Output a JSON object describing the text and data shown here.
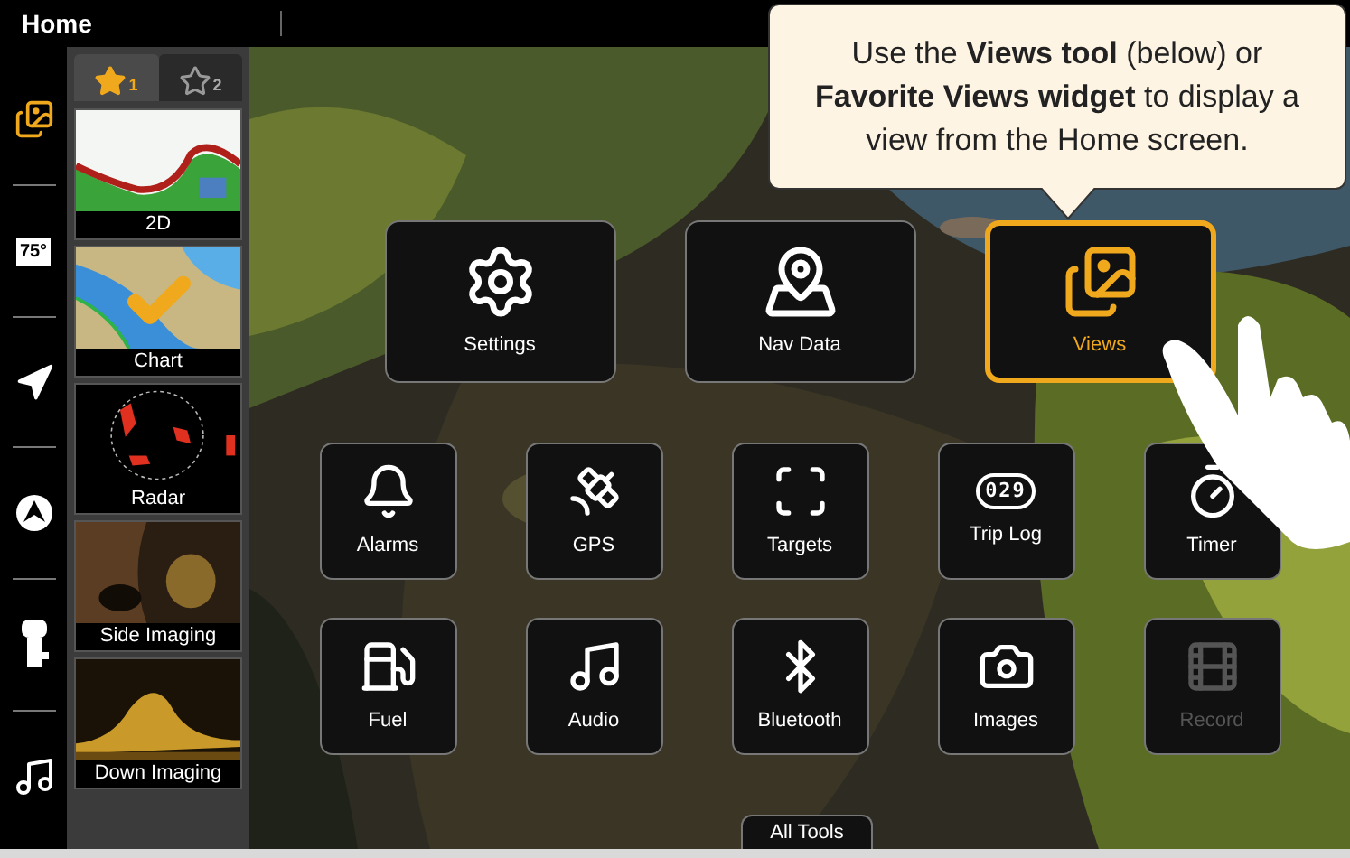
{
  "top_bar": {
    "title": "Home"
  },
  "rail": [
    {
      "selected": true
    },
    {
      "selected": false,
      "text": "75°"
    },
    {
      "selected": false
    },
    {
      "selected": false
    },
    {
      "selected": false
    },
    {
      "selected": false
    }
  ],
  "favorite_tabs": [
    {
      "label": "1",
      "selected": true
    },
    {
      "label": "2",
      "selected": false
    }
  ],
  "favorite_views": [
    {
      "label": "2D",
      "checked": false,
      "kind": "sonar"
    },
    {
      "label": "Chart",
      "checked": true,
      "kind": "chart"
    },
    {
      "label": "Radar",
      "checked": false,
      "kind": "radar"
    },
    {
      "label": "Side Imaging",
      "checked": false,
      "kind": "side"
    },
    {
      "label": "Down Imaging",
      "checked": false,
      "kind": "down"
    }
  ],
  "callout": "Use the **Views tool** (below) or **Favorite Views widget** to display a view from the Home screen.",
  "main_tiles": [
    {
      "label": "Settings",
      "selected": false
    },
    {
      "label": "Nav Data",
      "selected": false
    },
    {
      "label": "Views",
      "selected": true
    }
  ],
  "tool_tiles": [
    {
      "label": "Alarms",
      "disabled": false
    },
    {
      "label": "GPS",
      "disabled": false
    },
    {
      "label": "Targets",
      "disabled": false
    },
    {
      "label": "Trip Log",
      "disabled": false,
      "icon_text": "029"
    },
    {
      "label": "Timer",
      "disabled": false
    },
    {
      "label": "Fuel",
      "disabled": false
    },
    {
      "label": "Audio",
      "disabled": false
    },
    {
      "label": "Bluetooth",
      "disabled": false
    },
    {
      "label": "Images",
      "disabled": false
    },
    {
      "label": "Record",
      "disabled": true
    }
  ],
  "all_tools_button": "All Tools"
}
